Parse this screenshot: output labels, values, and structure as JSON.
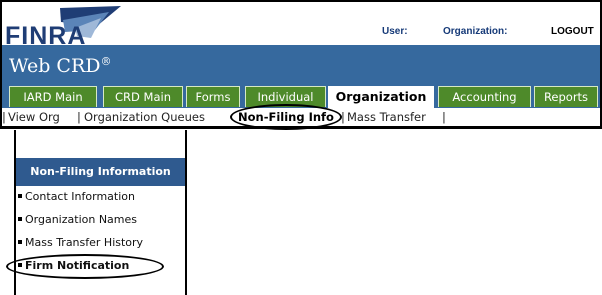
{
  "header": {
    "logo_text": "FINRA",
    "user_label": "User:",
    "organization_label": "Organization:",
    "logout_label": "LOGOUT",
    "app_title": "Web CRD",
    "registered_mark": "®"
  },
  "tabs": [
    {
      "label": "IARD Main"
    },
    {
      "label": "CRD Main"
    },
    {
      "label": "Forms"
    },
    {
      "label": "Individual"
    },
    {
      "label": "Organization",
      "active": true
    },
    {
      "label": "Accounting"
    },
    {
      "label": "Reports"
    }
  ],
  "subnav": {
    "separator": "|",
    "items": [
      "View Org",
      "Organization Queues",
      "Non-Filing Info",
      "Mass Transfer"
    ]
  },
  "sidebar": {
    "header": "Non-Filing Information",
    "items": [
      {
        "label": "Contact Information"
      },
      {
        "label": "Organization Names"
      },
      {
        "label": "Mass Transfer History"
      },
      {
        "label": "Firm Notification",
        "highlighted": true
      }
    ]
  },
  "colors": {
    "banner": "#36699e",
    "tab": "#4e8a2a",
    "sidebar_header": "#2f5a8f",
    "logo": "#1f3d75"
  }
}
